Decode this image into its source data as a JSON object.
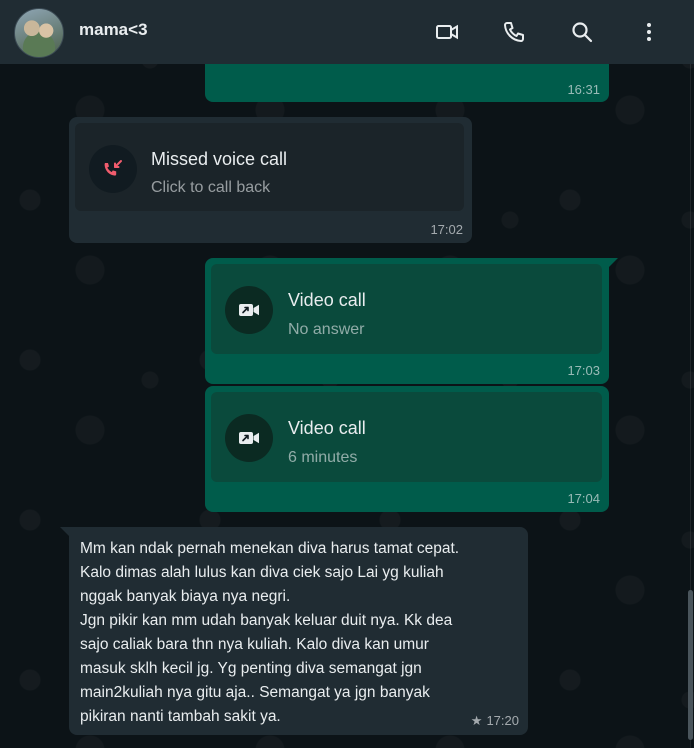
{
  "header": {
    "contact_name": "mama<3",
    "icons": [
      "video-call-icon",
      "voice-call-icon",
      "search-icon",
      "menu-icon"
    ]
  },
  "messages": [
    {
      "type": "outgoing-partial",
      "time": "16:31"
    },
    {
      "type": "incoming-call",
      "title": "Missed voice call",
      "subtitle": "Click to call back",
      "time": "17:02",
      "icon": "missed-call-icon"
    },
    {
      "type": "outgoing-call",
      "title": "Video call",
      "subtitle": "No answer",
      "time": "17:03",
      "icon": "video-call-icon"
    },
    {
      "type": "outgoing-call",
      "title": "Video call",
      "subtitle": "6 minutes",
      "time": "17:04",
      "icon": "video-call-icon"
    },
    {
      "type": "incoming-text",
      "text": "Mm kan ndak pernah menekan diva harus tamat cepat.\nKalo dimas alah lulus kan diva ciek sajo Lai yg kuliah\nnggak banyak biaya nya negri.\nJgn pikir kan mm udah banyak keluar duit nya. Kk dea\nsajo caliak bara thn nya kuliah. Kalo diva kan umur\nmasuk sklh kecil jg. Yg penting diva semangat jgn\nmain2kuliah nya gitu aja.. Semangat ya jgn banyak\npikiran nanti tambah sakit ya.",
      "time": "17:20",
      "starred": true,
      "star_glyph": "★"
    }
  ],
  "colors": {
    "header_bg": "#202c33",
    "outgoing_bubble": "#005c4b",
    "incoming_bubble": "#202c33",
    "missed_call_red": "#f15c6d",
    "icon_color": "#e9edef"
  }
}
